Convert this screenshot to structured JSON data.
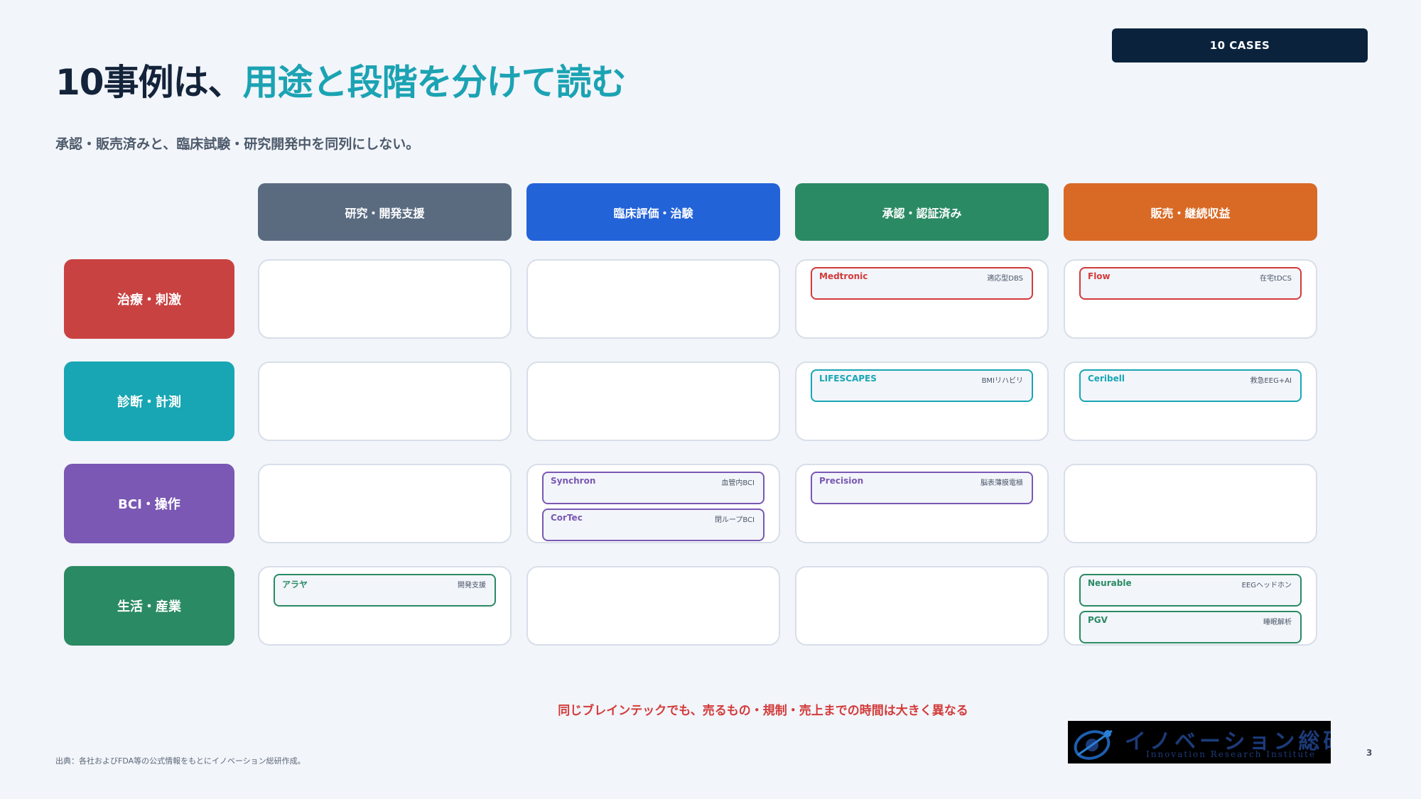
{
  "badge": "10 CASES",
  "title": {
    "prefix": "10事例は、",
    "accent": "用途と段階を分けて読む"
  },
  "subtitle": "承認・販売済みと、臨床試験・研究開発中を同列にしない。",
  "columns": [
    {
      "label": "研究・開発支援",
      "color": "#5a6b80"
    },
    {
      "label": "臨床評価・治験",
      "color": "#2363d8"
    },
    {
      "label": "承認・認証済み",
      "color": "#2a8a63"
    },
    {
      "label": "販売・継続収益",
      "color": "#d86a26"
    }
  ],
  "rows": [
    {
      "label": "治療・刺激",
      "color": "#c94242",
      "accent": "#d33b3b"
    },
    {
      "label": "診断・計測",
      "color": "#18a6b4",
      "accent": "#18a6b4"
    },
    {
      "label": "BCI・操作",
      "color": "#7a58b3",
      "accent": "#7a58b3"
    },
    {
      "label": "生活・産業",
      "color": "#2a8a63",
      "accent": "#2a8a63"
    }
  ],
  "cases": [
    {
      "row": 0,
      "col": 2,
      "name": "Medtronic",
      "tag": "適応型DBS"
    },
    {
      "row": 0,
      "col": 3,
      "name": "Flow",
      "tag": "在宅tDCS"
    },
    {
      "row": 1,
      "col": 2,
      "name": "LIFESCAPES",
      "tag": "BMIリハビリ"
    },
    {
      "row": 1,
      "col": 3,
      "name": "Ceribell",
      "tag": "救急EEG+AI"
    },
    {
      "row": 2,
      "col": 1,
      "name": "Synchron",
      "tag": "血管内BCI"
    },
    {
      "row": 2,
      "col": 1,
      "name": "CorTec",
      "tag": "閉ループBCI"
    },
    {
      "row": 2,
      "col": 2,
      "name": "Precision",
      "tag": "脳表薄膜電極"
    },
    {
      "row": 3,
      "col": 0,
      "name": "アラヤ",
      "tag": "開発支援"
    },
    {
      "row": 3,
      "col": 3,
      "name": "Neurable",
      "tag": "EEGヘッドホン"
    },
    {
      "row": 3,
      "col": 3,
      "name": "PGV",
      "tag": "睡眠解析"
    }
  ],
  "message": "同じブレインテックでも、売るもの・規制・売上までの時間は大きく異なる",
  "source": "出典：各社およびFDA等の公式情報をもとにイノベーション総研作成。",
  "logo": {
    "ja": "イノベーション総研",
    "en": "Innovation Research Institute"
  },
  "page_number": "3"
}
